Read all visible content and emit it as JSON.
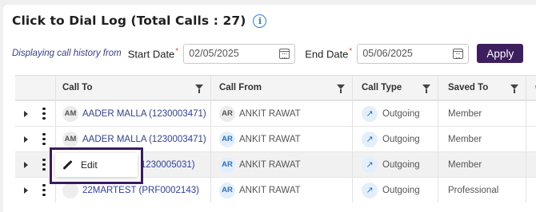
{
  "header": {
    "title": "Click to Dial Log (Total Calls : 27)",
    "info_icon": "info-icon"
  },
  "filters": {
    "hint": "Displaying call history from",
    "start_label": "Start Date",
    "start_value": "02/05/2025",
    "end_label": "End Date",
    "end_value": "05/06/2025",
    "required_mark": "*",
    "apply_label": "Apply",
    "calendar_icon": "calendar-icon"
  },
  "table": {
    "columns": [
      "Call To",
      "Call From",
      "Call Type",
      "Saved To",
      "C"
    ],
    "rows": [
      {
        "to_initials": "AM",
        "to": "AADER MALLA (1230003471)",
        "from_initials": "AR",
        "from": "ANKIT RAWAT",
        "type": "Outgoing",
        "saved": "Member"
      },
      {
        "to_initials": "AM",
        "to": "AADER MALLA (1230003471)",
        "from_initials": "AR",
        "from": "ANKIT RAWAT",
        "type": "Outgoing",
        "saved": "Member"
      },
      {
        "to_initials": "",
        "to": "(1230005031)",
        "from_initials": "AR",
        "from": "ANKIT RAWAT",
        "type": "Outgoing",
        "saved": "Member"
      },
      {
        "to_initials": "",
        "to": "22MARTEST (PRF0002143)",
        "from_initials": "AR",
        "from": "ANKIT RAWAT",
        "type": "Outgoing",
        "saved": "Professional"
      }
    ]
  },
  "context_menu": {
    "edit_label": "Edit",
    "pencil_icon": "pencil-icon"
  },
  "colors": {
    "accent": "#3d1e5e",
    "link": "#2e3e9e",
    "info_blue": "#2f7de1"
  }
}
